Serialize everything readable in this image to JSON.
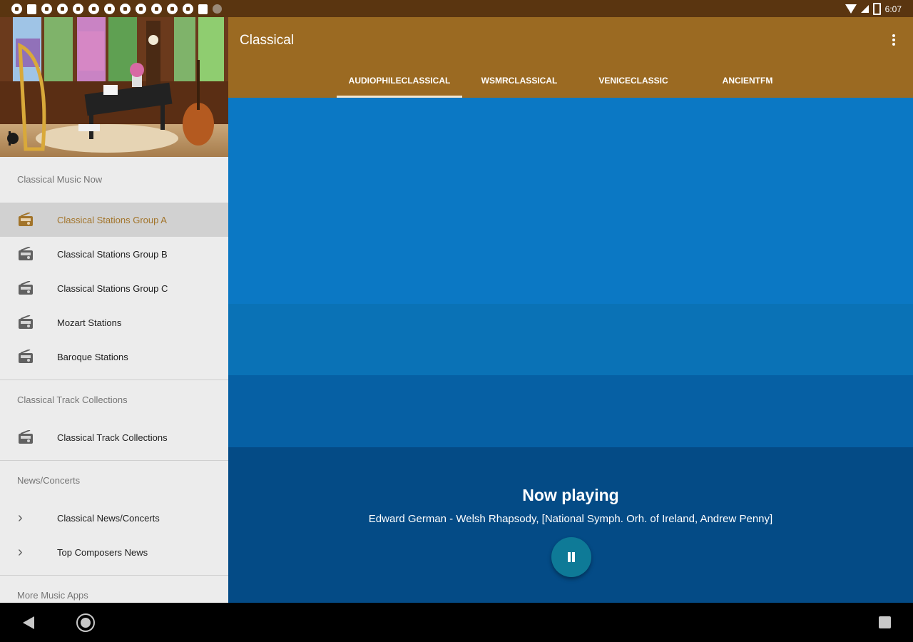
{
  "app": {
    "title": "Classical"
  },
  "status_bar": {
    "time": "6:07",
    "notification_icon_count": 13
  },
  "tabs": [
    {
      "label": "AUDIOPHILECLASSICAL",
      "active": true
    },
    {
      "label": "WSMRCLASSICAL",
      "active": false
    },
    {
      "label": "VENICECLASSIC",
      "active": false
    },
    {
      "label": "ANCIENTFM",
      "active": false
    }
  ],
  "drawer": {
    "sections": [
      {
        "header": "Classical Music Now",
        "items": [
          {
            "label": "Classical Stations Group A",
            "icon": "radio-icon",
            "selected": true
          },
          {
            "label": "Classical Stations Group B",
            "icon": "radio-icon"
          },
          {
            "label": "Classical Stations Group C",
            "icon": "radio-icon"
          },
          {
            "label": "Mozart Stations",
            "icon": "radio-icon"
          },
          {
            "label": "Baroque Stations",
            "icon": "radio-icon"
          }
        ]
      },
      {
        "header": "Classical Track Collections",
        "items": [
          {
            "label": "Classical Track Collections",
            "icon": "radio-icon"
          }
        ]
      },
      {
        "header": "News/Concerts",
        "items": [
          {
            "label": "Classical News/Concerts",
            "icon": "chevron-right-icon"
          },
          {
            "label": "Top Composers News",
            "icon": "chevron-right-icon"
          }
        ]
      },
      {
        "header": "More Music Apps",
        "items": []
      }
    ]
  },
  "player": {
    "title": "Now playing",
    "track": "Edward German - Welsh Rhapsody, [National Symph. Orh. of Ireland, Andrew Penny]",
    "state": "playing"
  },
  "colors": {
    "status_bar": "#5a3510",
    "app_bar": "#9b6a22",
    "accent": "#a2742a",
    "drawer_bg": "#ececec",
    "band_1": "#0b78c4",
    "band_2": "#0a72b6",
    "band_3": "#0660a4",
    "player_bg": "#044b86",
    "fab": "#0e7a97"
  }
}
